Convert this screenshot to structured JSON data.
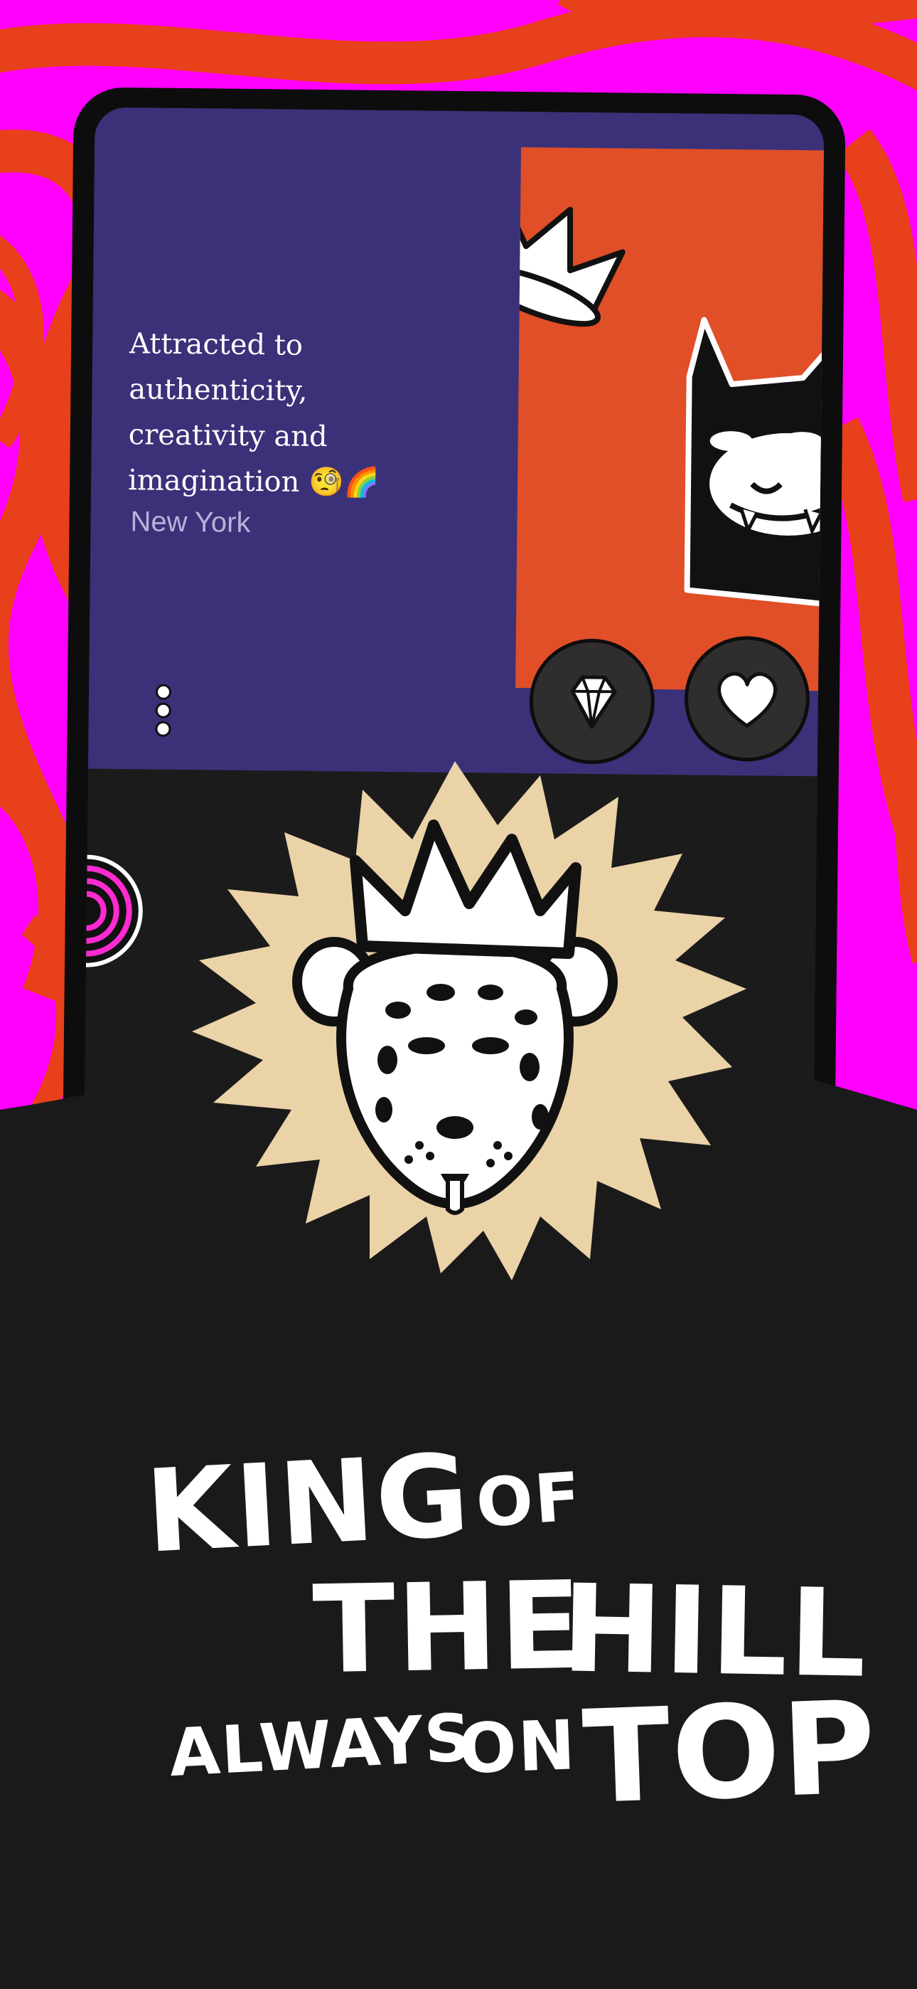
{
  "profile": {
    "bio": "Attracted to\nauthenticity,\ncreativity and\nimagination 🧐🌈",
    "location": "New York"
  },
  "headline": {
    "word1": "KING",
    "word2": "OF",
    "word3": "THE",
    "word4": "HILL",
    "word5": "ALWAYS",
    "word6": "ON",
    "word7": "TOP"
  },
  "icons": {
    "more": "more-vertical-icon",
    "gem": "diamond-icon",
    "like": "heart-icon",
    "mascot": "crowned-leopard-illustration"
  },
  "colors": {
    "magenta": "#ff00ff",
    "orange": "#e8401a",
    "purple": "#3b3179",
    "card_orange": "#e04f27",
    "dark": "#1b1a1a",
    "burst": "#ebd3a8"
  }
}
